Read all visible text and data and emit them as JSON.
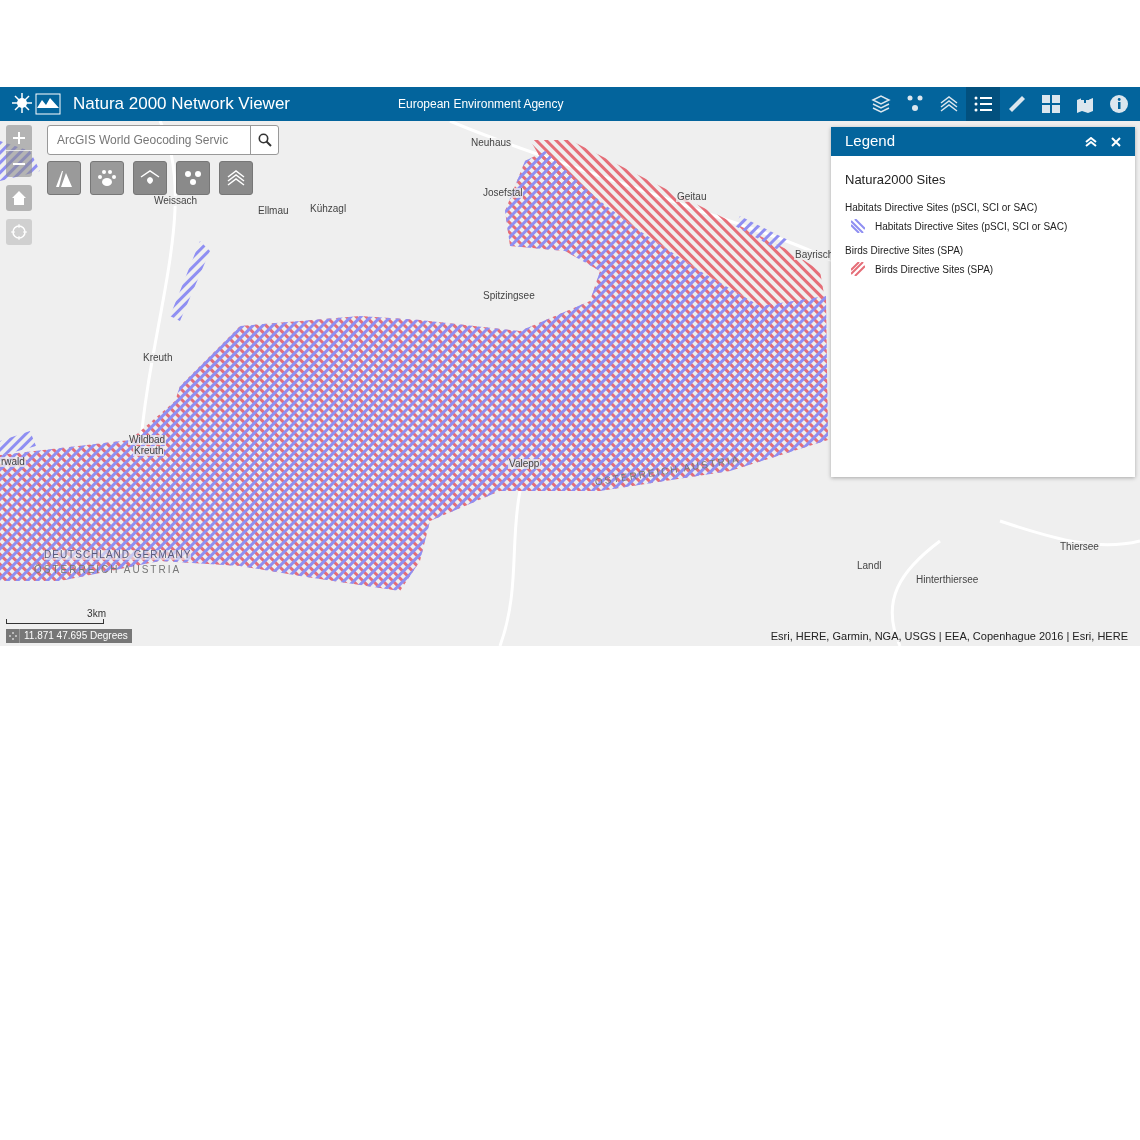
{
  "header": {
    "title": "Natura 2000 Network Viewer",
    "organization": "European Environment Agency"
  },
  "toolbar": [
    {
      "selected": false
    },
    {
      "selected": false
    },
    {
      "selected": false
    },
    {
      "selected": true
    },
    {
      "selected": false
    },
    {
      "selected": false
    },
    {
      "selected": false
    },
    {
      "selected": false
    }
  ],
  "search": {
    "placeholder": "ArcGIS World Geocoding Servic"
  },
  "map_labels": [
    {
      "text": "Neuhaus",
      "kind": "place"
    },
    {
      "text": "Josefstal",
      "kind": "place"
    },
    {
      "text": "Geitau",
      "kind": "place"
    },
    {
      "text": "Bayrisch",
      "kind": "place"
    },
    {
      "text": "Spitzingsee",
      "kind": "place"
    },
    {
      "text": "Weissach",
      "kind": "place"
    },
    {
      "text": "Ellmau",
      "kind": "place"
    },
    {
      "text": "Kühzagl",
      "kind": "place"
    },
    {
      "text": "Kreuth",
      "kind": "place"
    },
    {
      "text": "Wildbad",
      "kind": "place"
    },
    {
      "text": "Kreuth",
      "kind": "place"
    },
    {
      "text": "rwald",
      "kind": "place"
    },
    {
      "text": "Valepp",
      "kind": "place"
    },
    {
      "text": "DEUTSCHLAND GERMANY",
      "kind": "border"
    },
    {
      "text": "ÖSTERREICH AUSTRIA",
      "kind": "country"
    },
    {
      "text": "ÖSTERREICH AUSTRIA",
      "kind": "country"
    },
    {
      "text": "Thiersee",
      "kind": "place"
    },
    {
      "text": "Landl",
      "kind": "place"
    },
    {
      "text": "Hinterthiersee",
      "kind": "place"
    }
  ],
  "legend": {
    "title": "Legend",
    "layer_title": "Natura2000 Sites",
    "groups": [
      {
        "heading": "Habitats Directive Sites (pSCI, SCI or SAC)",
        "item": "Habitats Directive Sites (pSCI, SCI or SAC)",
        "color": "#8f8ff2"
      },
      {
        "heading": "Birds Directive Sites (SPA)",
        "item": "Birds Directive Sites (SPA)",
        "color": "#e56e78"
      }
    ]
  },
  "scale_bar": "3km",
  "coordinates": "11.871 47.695 Degrees",
  "attribution": "Esri, HERE, Garmin, NGA, USGS | EEA, Copenhague 2016 | Esri, HERE"
}
